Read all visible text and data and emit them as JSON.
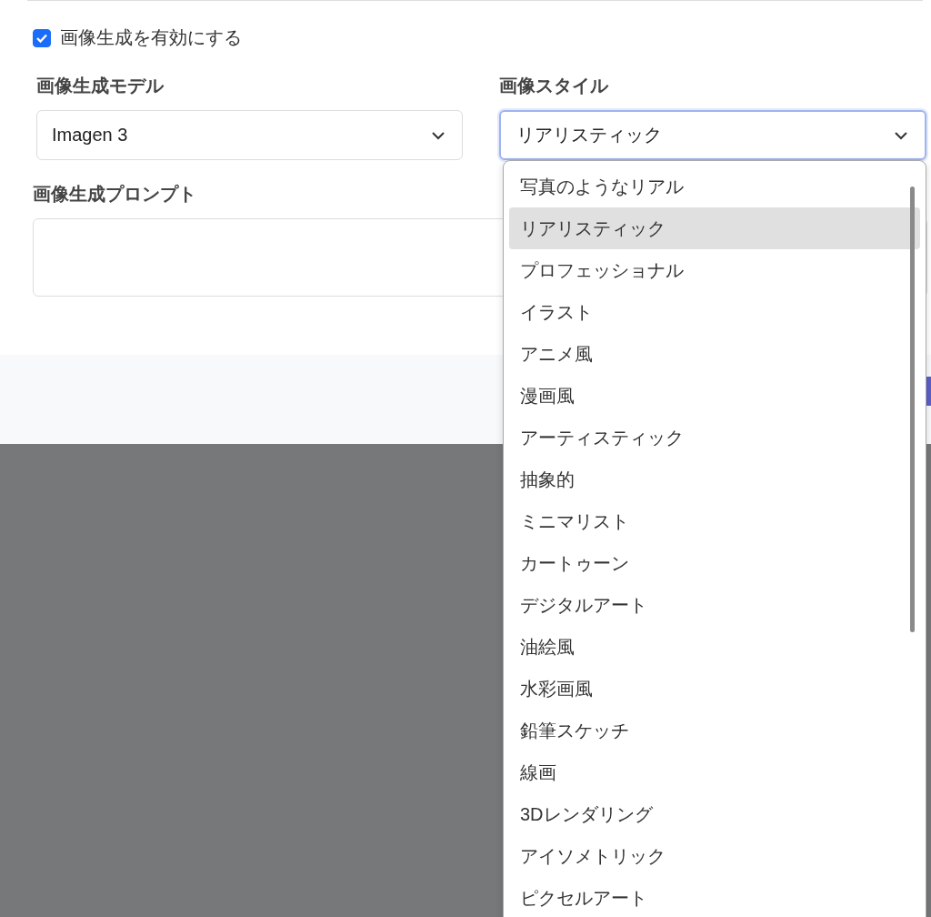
{
  "enable_checkbox": {
    "label": "画像生成を有効にする",
    "checked": true
  },
  "model_select": {
    "label": "画像生成モデル",
    "value": "Imagen 3"
  },
  "style_select": {
    "label": "画像スタイル",
    "value": "リアリスティック",
    "expanded": true,
    "options": [
      {
        "label": "写真のようなリアル",
        "selected": false
      },
      {
        "label": "リアリスティック",
        "selected": true
      },
      {
        "label": "プロフェッショナル",
        "selected": false
      },
      {
        "label": "イラスト",
        "selected": false
      },
      {
        "label": "アニメ風",
        "selected": false
      },
      {
        "label": "漫画風",
        "selected": false
      },
      {
        "label": "アーティスティック",
        "selected": false
      },
      {
        "label": "抽象的",
        "selected": false
      },
      {
        "label": "ミニマリスト",
        "selected": false
      },
      {
        "label": "カートゥーン",
        "selected": false
      },
      {
        "label": "デジタルアート",
        "selected": false
      },
      {
        "label": "油絵風",
        "selected": false
      },
      {
        "label": "水彩画風",
        "selected": false
      },
      {
        "label": "鉛筆スケッチ",
        "selected": false
      },
      {
        "label": "線画",
        "selected": false
      },
      {
        "label": "3Dレンダリング",
        "selected": false
      },
      {
        "label": "アイソメトリック",
        "selected": false
      },
      {
        "label": "ピクセルアート",
        "selected": false
      }
    ]
  },
  "prompt_field": {
    "label": "画像生成プロンプト"
  }
}
